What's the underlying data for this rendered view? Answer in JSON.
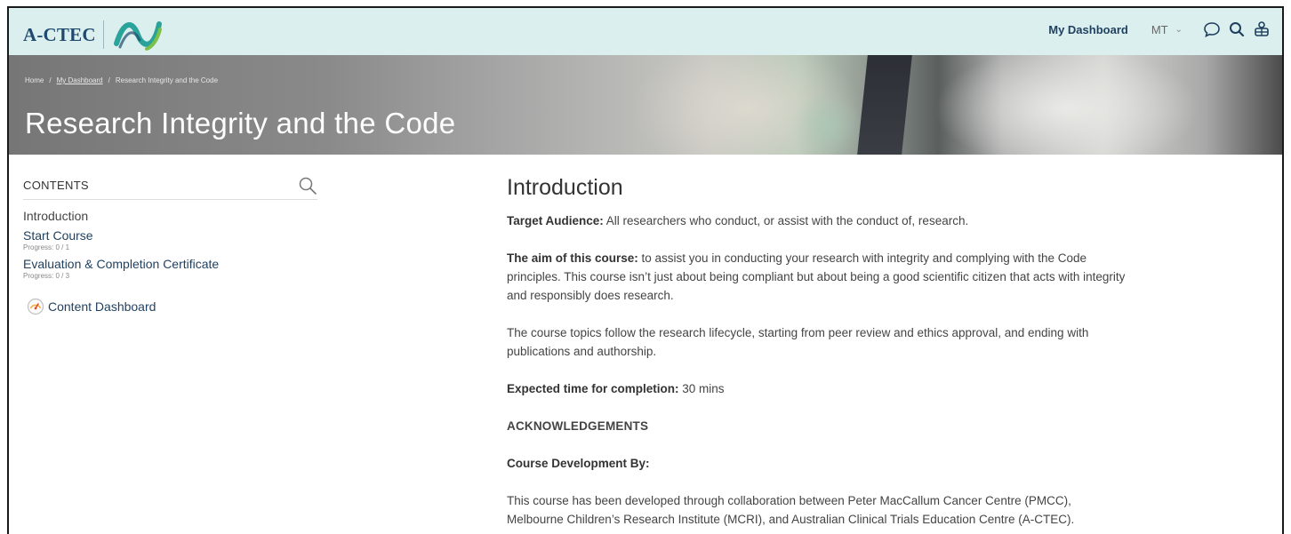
{
  "header": {
    "brand": "A-CTEC",
    "nav_dashboard": "My Dashboard",
    "user_initials": "MT",
    "user_caret": "⌄"
  },
  "banner": {
    "breadcrumb": [
      "Home",
      "/",
      "My Dashboard",
      "/",
      "Research Integrity and the Code"
    ],
    "title": "Research Integrity and the Code"
  },
  "sidebar": {
    "contents_title": "CONTENTS",
    "items": [
      {
        "label": "Introduction"
      },
      {
        "label": "Start Course",
        "progress": "Progress: 0 / 1"
      },
      {
        "label": "Evaluation & Completion Certificate",
        "progress": "Progress: 0 / 3"
      }
    ],
    "content_dashboard": "Content Dashboard"
  },
  "main": {
    "heading": "Introduction",
    "target_label": "Target Audience:",
    "target_text": " All researchers who conduct, or assist with the conduct of, research.",
    "aim_label": "The aim of this course:",
    "aim_text": " to assist you in conducting your research with integrity and complying with the Code principles. This course isn’t just about being compliant but about being a good scientific citizen that acts with integrity and responsibly does research.",
    "topics_text": "The course topics follow the research lifecycle, starting from peer review and ethics approval, and ending with publications and authorship.",
    "time_label": "Expected time for completion:",
    "time_text": " 30 mins",
    "ack_heading": "ACKNOWLEDGEMENTS",
    "dev_label": "Course Development By:",
    "dev_text": "This course has been developed through collaboration between Peter MacCallum Cancer Centre (PMCC), Melbourne Children’s Research Institute (MCRI), and Australian Clinical Trials Education Centre (A-CTEC)."
  },
  "colors": {
    "header_bg": "#dcefef",
    "brand": "#1f4a6e",
    "link": "#1f3f5e",
    "logo_teal": "#2aa39a",
    "logo_green": "#7cc04a"
  },
  "icons": [
    "brand-logo-icon",
    "chat-icon",
    "search-icon",
    "support-icon",
    "contents-search-icon",
    "dashboard-gauge-icon"
  ]
}
